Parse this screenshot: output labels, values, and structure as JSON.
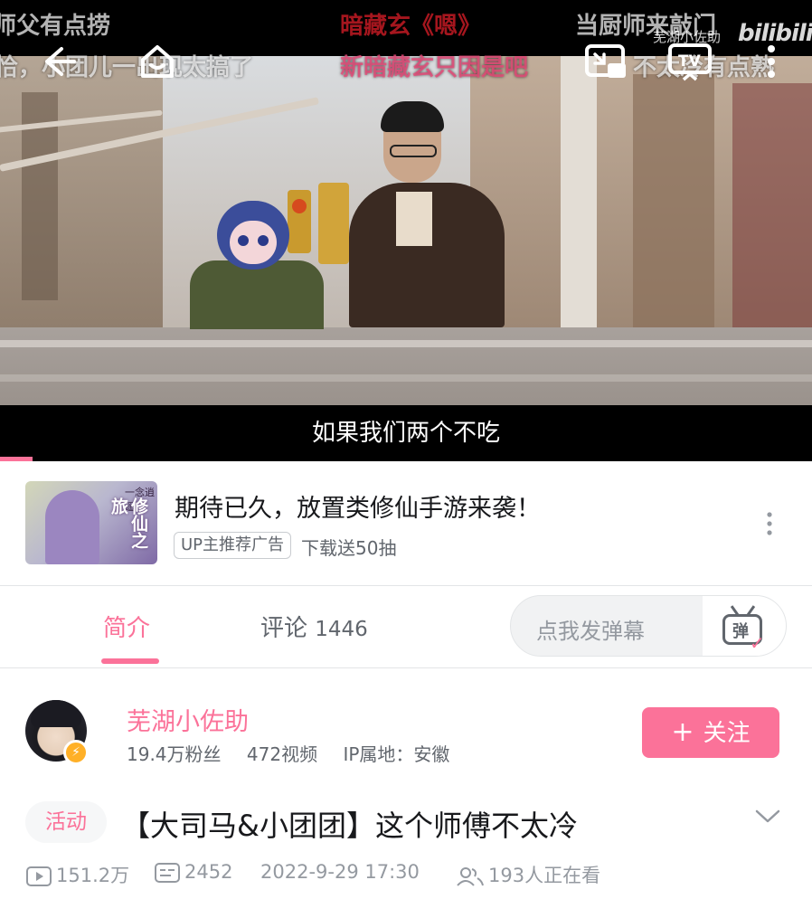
{
  "player": {
    "subtitle": "如果我们两个不吃",
    "watermark_text": "芜湖小佐助",
    "watermark_logo": "bilibili",
    "progress_fraction": 0.04,
    "danmaku": [
      {
        "text": "师父有点捞",
        "color": "white"
      },
      {
        "text": "暗藏玄《嗯》",
        "color": "red"
      },
      {
        "text": "当厨师来敲门",
        "color": "white"
      },
      {
        "text": "恰，小团儿一出现太搞了",
        "color": "white"
      },
      {
        "text": "新暗藏玄只因是吧",
        "color": "pink"
      },
      {
        "text": "不太冷有点熟",
        "color": "white"
      }
    ],
    "icons": [
      "back-icon",
      "home-icon",
      "pip-icon",
      "cast-tv-icon",
      "more-vertical-icon"
    ]
  },
  "ad": {
    "thumb_title": "修仙之旅",
    "thumb_logo": "一念逍遥",
    "title": "期待已久，放置类修仙手游来袭！",
    "badge": "UP主推荐广告",
    "subtitle": "下载送50抽"
  },
  "tabs": {
    "intro": "简介",
    "comments_label": "评论",
    "comments_count": "1446",
    "danmu_placeholder": "点我发弹幕",
    "danmu_button": "弹"
  },
  "uploader": {
    "name": "芜湖小佐助",
    "followers": "19.4万粉丝",
    "videos": "472视频",
    "ip": "IP属地：安徽",
    "follow_label": "关注",
    "follow_plus": "+"
  },
  "video": {
    "tag": "活动",
    "title": "【大司马&小团团】这个师傅不太冷",
    "views": "151.2万",
    "danmaku_count": "2452",
    "publish_time": "2022-9-29 17:30",
    "watching": "193人正在看"
  },
  "colors": {
    "accent": "#fb7299",
    "text_primary": "#18191c",
    "text_secondary": "#61666d",
    "text_tertiary": "#9499a0"
  }
}
